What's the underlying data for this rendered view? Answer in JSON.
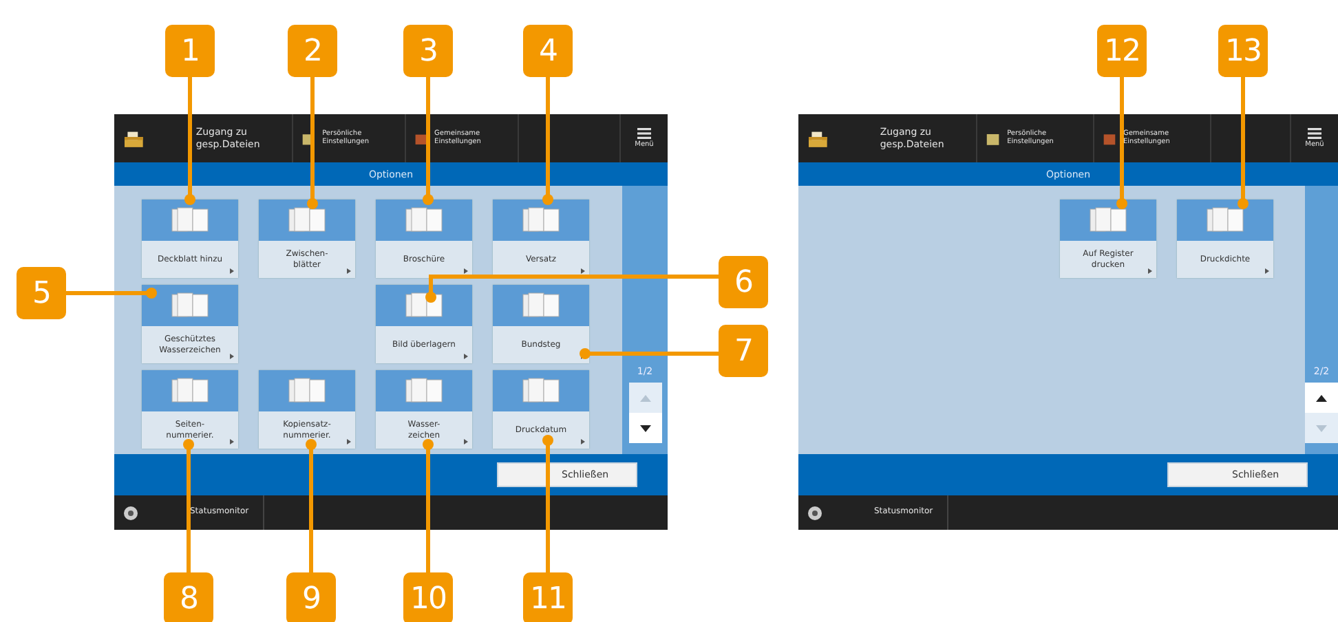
{
  "screens": [
    {
      "top_bar": {
        "files_label": "Zugang zu gesp.Dateien",
        "shortcuts": [
          "Persönliche Einstellungen",
          "Gemeinsame Einstellungen"
        ],
        "menu_label": "Menü"
      },
      "title": "Optionen",
      "cells": [
        {
          "kind": "tile",
          "label": "Deckblatt hinzu"
        },
        {
          "kind": "tile",
          "label": "Zwischen-\nblätter"
        },
        {
          "kind": "tile",
          "label": "Broschüre"
        },
        {
          "kind": "tile",
          "label": "Versatz"
        },
        {
          "kind": "tile",
          "label": "Geschütztes Wasserzeichen"
        },
        {
          "kind": "empty"
        },
        {
          "kind": "tile",
          "label": "Bild überlagern"
        },
        {
          "kind": "tile",
          "label": "Bundsteg"
        },
        {
          "kind": "tile",
          "label": "Seiten-\nnummerier."
        },
        {
          "kind": "tile",
          "label": "Kopiensatz-\nnummerier."
        },
        {
          "kind": "tile",
          "label": "Wasser-\nzeichen"
        },
        {
          "kind": "tile",
          "label": "Druckdatum"
        }
      ],
      "page": "1/2",
      "up_enabled": false,
      "down_enabled": true,
      "close_label": "Schließen",
      "status_label": "Statusmonitor"
    },
    {
      "top_bar": {
        "files_label": "Zugang zu gesp.Dateien",
        "shortcuts": [
          "Persönliche Einstellungen",
          "Gemeinsame Einstellungen"
        ],
        "menu_label": "Menü"
      },
      "title": "Optionen",
      "cells": [
        {
          "kind": "empty"
        },
        {
          "kind": "empty"
        },
        {
          "kind": "tile",
          "label": "Auf Register drucken"
        },
        {
          "kind": "tile",
          "label": "Druckdichte"
        }
      ],
      "page": "2/2",
      "up_enabled": true,
      "down_enabled": false,
      "close_label": "Schließen",
      "status_label": "Statusmonitor"
    }
  ],
  "callouts": [
    "1",
    "2",
    "3",
    "4",
    "5",
    "6",
    "7",
    "8",
    "9",
    "10",
    "11",
    "12",
    "13"
  ]
}
